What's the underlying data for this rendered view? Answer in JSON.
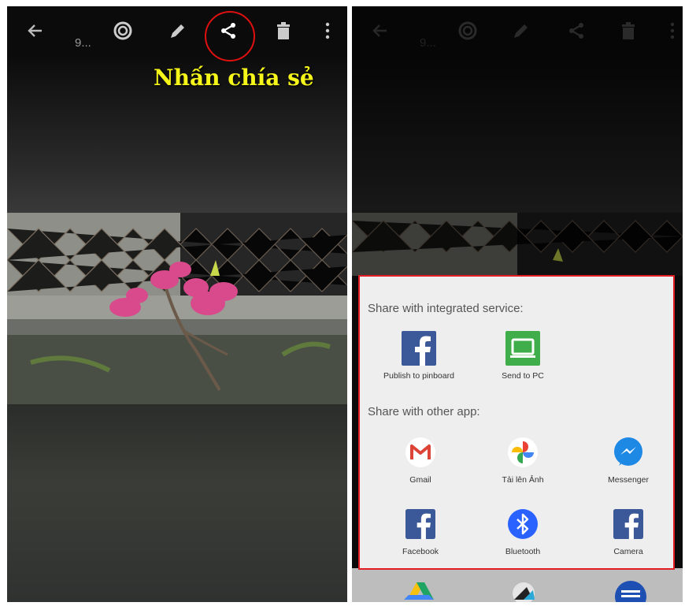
{
  "left_panel": {
    "photo_counter": "9...",
    "callout": "Nhấn chía sẻ",
    "toolbar_icons": [
      "back-arrow-icon",
      "spiral-icon",
      "edit-icon",
      "share-icon",
      "trash-icon",
      "more-vert-icon"
    ]
  },
  "right_panel": {
    "photo_counter": "9...",
    "share_sheet": {
      "integrated_heading": "Share with integrated service:",
      "integrated_apps": [
        {
          "label": "Publish to pinboard",
          "icon": "facebook-icon"
        },
        {
          "label": "Send to PC",
          "icon": "pc-icon"
        }
      ],
      "other_heading": "Share with other app:",
      "other_apps": [
        {
          "label": "Gmail",
          "icon": "gmail-icon"
        },
        {
          "label": "Tải lên Ảnh",
          "icon": "photos-icon"
        },
        {
          "label": "Messenger",
          "icon": "messenger-icon"
        },
        {
          "label": "Facebook",
          "icon": "facebook-icon"
        },
        {
          "label": "Bluetooth",
          "icon": "bluetooth-icon"
        },
        {
          "label": "Camera",
          "icon": "facebook-icon"
        }
      ]
    }
  },
  "colors": {
    "highlight_red": "#e41c23",
    "callout_yellow": "#f5f51a",
    "facebook_blue": "#3b5998",
    "pc_green": "#3fae4a",
    "bluetooth_blue": "#2962ff",
    "messenger_blue": "#1e88e5"
  }
}
